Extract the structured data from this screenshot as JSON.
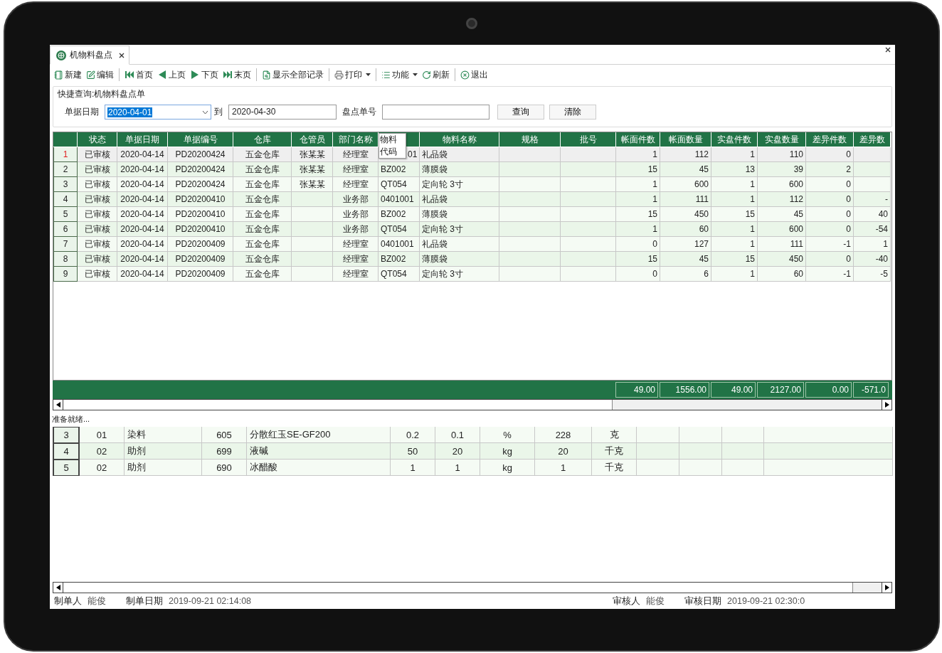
{
  "tab": {
    "label": "机物料盘点",
    "selected": true
  },
  "toolbar": [
    [
      {
        "kind": "new",
        "label": "新建",
        "dropdown": false
      },
      {
        "kind": "edit",
        "label": "编辑",
        "dropdown": false
      }
    ],
    [
      {
        "kind": "first",
        "label": "首页",
        "dropdown": false
      },
      {
        "kind": "prev",
        "label": "上页",
        "dropdown": false
      },
      {
        "kind": "next",
        "label": "下页",
        "dropdown": false
      },
      {
        "kind": "last",
        "label": "末页",
        "dropdown": false
      }
    ],
    [
      {
        "kind": "search",
        "label": "显示全部记录",
        "dropdown": false
      }
    ],
    [
      {
        "kind": "print",
        "label": "打印",
        "dropdown": true
      }
    ],
    [
      {
        "kind": "list",
        "label": "功能",
        "dropdown": true
      },
      {
        "kind": "refresh",
        "label": "刷新",
        "dropdown": false
      }
    ],
    [
      {
        "kind": "exit",
        "label": "退出",
        "dropdown": false
      }
    ]
  ],
  "query": {
    "title": "快捷查询:机物料盘点单",
    "date_label": "单据日期",
    "date_from": "2020-04-01",
    "date_from_highlighted": true,
    "to_label": "到",
    "date_to": "2020-04-30",
    "number_label": "盘点单号",
    "buttons": [
      "查询",
      "清除"
    ]
  },
  "grid": {
    "columns": [
      {
        "label": "状态"
      },
      {
        "label": "单据日期"
      },
      {
        "label": "单据编号"
      },
      {
        "label": "仓库"
      },
      {
        "label": "仓管员"
      },
      {
        "label": "部门名称"
      },
      {
        "tooltip": "物料代码"
      },
      {
        "label": "物料名称"
      },
      {
        "label": "规格"
      },
      {
        "label": "批号"
      },
      {
        "label": "帐面件数"
      },
      {
        "label": "帐面数量"
      },
      {
        "label": "实盘件数"
      },
      {
        "label": "实盘数量"
      },
      {
        "label": "差异件数"
      },
      {
        "label": "差异数"
      }
    ],
    "rows": [
      {
        "number": "1",
        "selected": true,
        "code_covered": true,
        "cells": [
          "已审核",
          "2020-04-14",
          "PD20200424",
          "五金仓库",
          "张某某",
          "经理室",
          "01",
          "礼品袋",
          null,
          null,
          "1",
          "112",
          "1",
          "110",
          "0",
          null
        ]
      },
      {
        "number": "2",
        "selected": false,
        "code_covered": false,
        "cells": [
          "已审核",
          "2020-04-14",
          "PD20200424",
          "五金仓库",
          "张某某",
          "经理室",
          "BZ002",
          "薄膜袋",
          null,
          null,
          "15",
          "45",
          "13",
          "39",
          "2",
          null
        ]
      },
      {
        "number": "3",
        "selected": false,
        "code_covered": false,
        "cells": [
          "已审核",
          "2020-04-14",
          "PD20200424",
          "五金仓库",
          "张某某",
          "经理室",
          "QT054",
          "定向轮 3寸",
          null,
          null,
          "1",
          "600",
          "1",
          "600",
          "0",
          null
        ]
      },
      {
        "number": "4",
        "selected": false,
        "code_covered": false,
        "cells": [
          "已审核",
          "2020-04-14",
          "PD20200410",
          "五金仓库",
          null,
          "业务部",
          "0401001",
          "礼品袋",
          null,
          null,
          "1",
          "111",
          "1",
          "112",
          "0",
          "-"
        ]
      },
      {
        "number": "5",
        "selected": false,
        "code_covered": false,
        "cells": [
          "已审核",
          "2020-04-14",
          "PD20200410",
          "五金仓库",
          null,
          "业务部",
          "BZ002",
          "薄膜袋",
          null,
          null,
          "15",
          "450",
          "15",
          "45",
          "0",
          "40"
        ]
      },
      {
        "number": "6",
        "selected": false,
        "code_covered": false,
        "cells": [
          "已审核",
          "2020-04-14",
          "PD20200410",
          "五金仓库",
          null,
          "业务部",
          "QT054",
          "定向轮 3寸",
          null,
          null,
          "1",
          "60",
          "1",
          "600",
          "0",
          "-54"
        ]
      },
      {
        "number": "7",
        "selected": false,
        "code_covered": false,
        "cells": [
          "已审核",
          "2020-04-14",
          "PD20200409",
          "五金仓库",
          null,
          "经理室",
          "0401001",
          "礼品袋",
          null,
          null,
          "0",
          "127",
          "1",
          "111",
          "-1",
          "1"
        ]
      },
      {
        "number": "8",
        "selected": false,
        "code_covered": false,
        "cells": [
          "已审核",
          "2020-04-14",
          "PD20200409",
          "五金仓库",
          null,
          "经理室",
          "BZ002",
          "薄膜袋",
          null,
          null,
          "15",
          "45",
          "15",
          "450",
          "0",
          "-40"
        ]
      },
      {
        "number": "9",
        "selected": false,
        "code_covered": false,
        "cells": [
          "已审核",
          "2020-04-14",
          "PD20200409",
          "五金仓库",
          null,
          "经理室",
          "QT054",
          "定向轮 3寸",
          null,
          null,
          "0",
          "6",
          "1",
          "60",
          "-1",
          "-5"
        ]
      }
    ],
    "totals": [
      "49.00",
      "1556.00",
      "49.00",
      "2127.00",
      "0.00",
      "-571.0"
    ]
  },
  "status": "准备就绪...",
  "detail_rows": [
    {
      "number": "3",
      "cells": [
        "01",
        "染料",
        "605",
        "分散红玉SE-GF200",
        "0.2",
        "0.1",
        "%",
        "228",
        "克",
        null,
        null,
        null,
        null
      ]
    },
    {
      "number": "4",
      "cells": [
        "02",
        "助剂",
        "699",
        "液碱",
        "50",
        "20",
        "kg",
        "20",
        "千克",
        null,
        null,
        null,
        null
      ]
    },
    {
      "number": "5",
      "cells": [
        "02",
        "助剂",
        "690",
        "冰醋酸",
        "1",
        "1",
        "kg",
        "1",
        "千克",
        null,
        null,
        null,
        null
      ]
    }
  ],
  "footer": [
    {
      "label": "制单人",
      "value": "能俊"
    },
    {
      "label": "制单日期",
      "value": "2019-09-21 02:14:08"
    },
    {
      "label": "审核人",
      "value": "能俊"
    },
    {
      "label": "审核日期",
      "value": "2019-09-21 02:30:0"
    }
  ]
}
